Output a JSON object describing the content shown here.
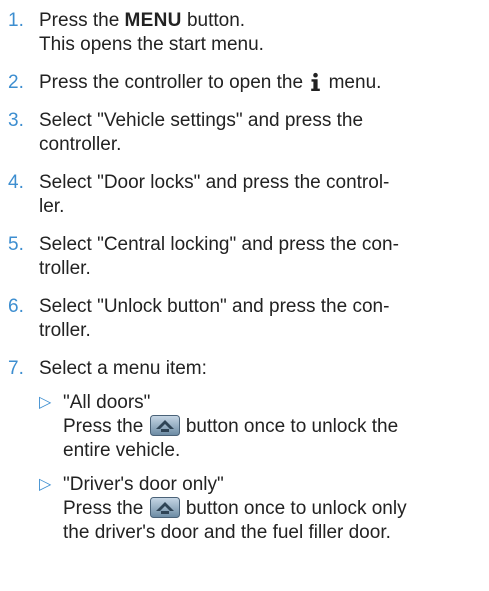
{
  "steps": [
    {
      "num": "1.",
      "a": "Press the ",
      "b": "MENU",
      "c": " button.",
      "d": "This opens the start menu."
    },
    {
      "num": "2.",
      "a": "Press the controller to open the ",
      "c": " menu."
    },
    {
      "num": "3.",
      "line1": "Select \"Vehicle settings\" and press the",
      "line2": "controller."
    },
    {
      "num": "4.",
      "line1": "Select \"Door locks\" and press the control-",
      "line2": "ler."
    },
    {
      "num": "5.",
      "line1": "Select \"Central locking\" and press the con-",
      "line2": "troller."
    },
    {
      "num": "6.",
      "line1": "Select \"Unlock button\" and press the con-",
      "line2": "troller."
    },
    {
      "num": "7.",
      "line1": "Select a menu item:"
    }
  ],
  "options": [
    {
      "title": "\"All doors\"",
      "pre": "Press the ",
      "post": " button once to unlock the",
      "rest": "entire vehicle."
    },
    {
      "title": "\"Driver's door only\"",
      "pre": "Press the ",
      "post": " button once to unlock only",
      "rest": "the driver's door and the fuel filler door."
    }
  ],
  "icons": {
    "bullet": "triangle-right-outline",
    "info": "info-i-icon",
    "unlock_button": "unlock-button-icon"
  },
  "colors": {
    "accent": "#3d8ed0",
    "text": "#222222"
  }
}
